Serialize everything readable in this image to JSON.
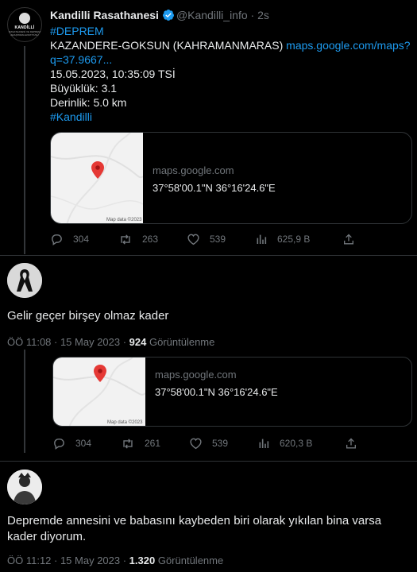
{
  "tweet": {
    "author_name": "Kandilli Rasathanesi",
    "handle": "@Kandilli_info",
    "time": "2s",
    "lines": {
      "hashtag1": "#DEPREM",
      "location": "KAZANDERE-GOKSUN (KAHRAMANMARAS)",
      "link_part1": "maps.google.com/maps?",
      "link_part2": "q=37.9667...",
      "datetime": "15.05.2023, 10:35:09 TSİ",
      "magnitude": "Büyüklük: 3.1",
      "depth": "Derinlik: 5.0 km",
      "hashtag2": "#Kandilli"
    },
    "avatar_text": "KANDİLLİ",
    "avatar_sub": "RASATHANESİ VE DEPREM ARAŞTIRMA ENSTİTÜSÜ",
    "card": {
      "domain": "maps.google.com",
      "coords": "37°58'00.1\"N 36°16'24.6\"E",
      "map_credit": "Map data ©2023"
    },
    "stats": {
      "replies": "304",
      "retweets": "263",
      "likes": "539",
      "views": "625,9 B"
    }
  },
  "embedded": {
    "card": {
      "domain": "maps.google.com",
      "coords": "37°58'00.1\"N 36°16'24.6\"E",
      "map_credit": "Map data ©2023"
    },
    "stats": {
      "replies": "304",
      "retweets": "261",
      "likes": "539",
      "views": "620,3 B"
    }
  },
  "reply1": {
    "text": "Gelir geçer birşey olmaz kader",
    "time": "ÖÖ 11:08 · 15 May 2023 · ",
    "views": "924",
    "views_label": " Görüntülenme"
  },
  "reply2": {
    "text_line1": "Depremde annesini ve babasını kaybeden biri olarak yıkılan bina varsa",
    "text_line2": "kader diyorum.",
    "time": "ÖÖ 11:12 · 15 May 2023 · ",
    "views": "1.320",
    "views_label": " Görüntülenme"
  },
  "colors": {
    "accent": "#1d9bf0",
    "muted": "#71767b",
    "text": "#e7e9ea",
    "pin": "#e53935"
  }
}
